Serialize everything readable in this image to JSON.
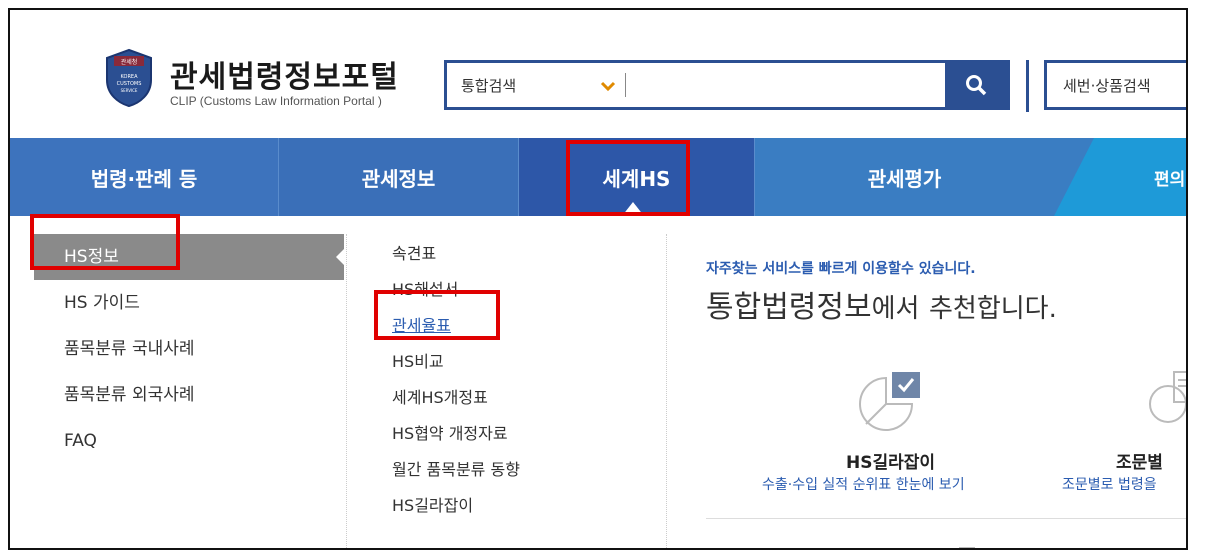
{
  "header": {
    "badge_text": "관세청 KOREA CUSTOMS SERVICE",
    "title": "관세법령정보포털",
    "subtitle": "CLIP (Customs Law Information Portal )",
    "search": {
      "scope": "통합검색",
      "value": "",
      "placeholder": ""
    },
    "tariff_search_label": "세번·상품검색"
  },
  "nav": {
    "items": [
      "법령·판례 등",
      "관세정보",
      "세계HS",
      "관세평가",
      "편의기능"
    ],
    "active_index": 2
  },
  "menu": {
    "col1": [
      "HS정보",
      "HS 가이드",
      "품목분류 국내사례",
      "품목분류 외국사례",
      "FAQ"
    ],
    "col1_active_index": 0,
    "col2": [
      "속견표",
      "HS해설서",
      "관세율표",
      "HS비교",
      "세계HS개정표",
      "HS협약 개정자료",
      "월간 품목분류 동향",
      "HS길라잡이"
    ],
    "col2_link_index": 2
  },
  "recommend": {
    "subtitle": "자주찾는 서비스를 빠르게 이용할수 있습니다.",
    "title_big": "통합법령정보",
    "title_mid": "에서",
    "title_small": "추천합니다.",
    "services": [
      {
        "title": "HS길라잡이",
        "desc": "수출·수입 실적 순위표 한눈에 보기",
        "icon": "pie-chart-icon"
      },
      {
        "title": "조문별",
        "desc": "조문별로 법령을",
        "icon": "document-search-icon"
      }
    ]
  },
  "colors": {
    "brand_blue": "#2b4f92",
    "nav_blue": "#3a6fb8",
    "highlight_red": "#e00000",
    "link_blue": "#2b5cb0"
  }
}
